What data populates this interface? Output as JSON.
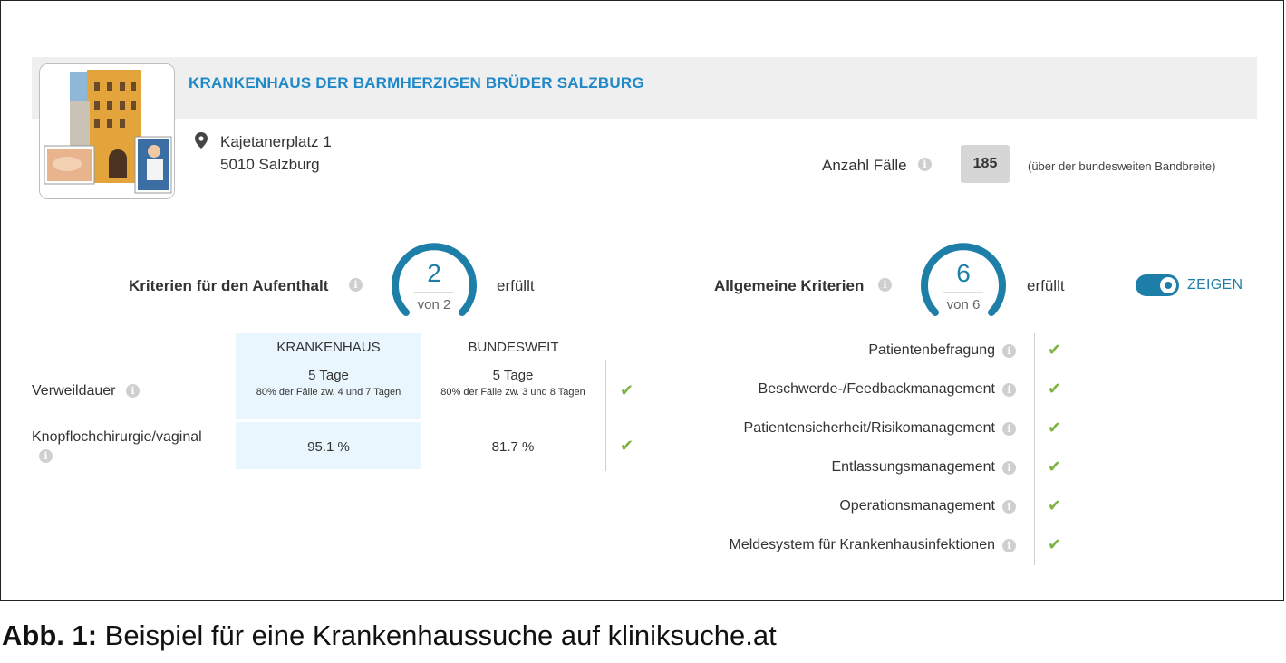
{
  "hospital": {
    "name": "KRANKENHAUS DER BARMHERZIGEN BRÜDER SALZBURG",
    "street": "Kajetanerplatz 1",
    "city": "5010 Salzburg"
  },
  "cases": {
    "label": "Anzahl Fälle",
    "value": "185",
    "note": "(über der bundesweiten Bandbreite)"
  },
  "stay_criteria": {
    "label": "Kriterien für den Aufenthalt",
    "fulfilled": "2",
    "of": "von 2",
    "status": "erfüllt",
    "fraction": 1.0
  },
  "general_criteria": {
    "label": "Allgemeine Kriterien",
    "fulfilled": "6",
    "of": "von 6",
    "status": "erfüllt",
    "fraction": 1.0
  },
  "toggle": {
    "label": "ZEIGEN",
    "on": true
  },
  "table": {
    "headers": [
      "KRANKENHAUS",
      "BUNDESWEIT"
    ],
    "rows": [
      {
        "label": "Verweildauer",
        "hospital_main": "5 Tage",
        "hospital_sub": "80% der Fälle zw. 4 und 7 Tagen",
        "national_main": "5 Tage",
        "national_sub": "80% der Fälle zw. 3 und 8 Tagen",
        "ok": true
      },
      {
        "label": "Knopflochchirurgie/vaginal",
        "hospital_main": "95.1 %",
        "national_main": "81.7 %",
        "ok": true
      }
    ]
  },
  "general_list": [
    "Patientenbefragung",
    "Beschwerde-/Feedbackmanagement",
    "Patientensicherheit/Risikomanagement",
    "Entlassungsmanagement",
    "Operationsmanagement",
    "Meldesystem für Krankenhausinfektionen"
  ],
  "caption": {
    "prefix": "Abb. 1:",
    "text": " Beispiel für eine Krankenhaussuche auf kliniksuche.at"
  },
  "colors": {
    "accent": "#1d7fa8",
    "title": "#1e88c8",
    "check": "#7cb342"
  },
  "icons": {
    "location": "map-pin-icon",
    "info": "info-icon",
    "check": "check-icon"
  }
}
